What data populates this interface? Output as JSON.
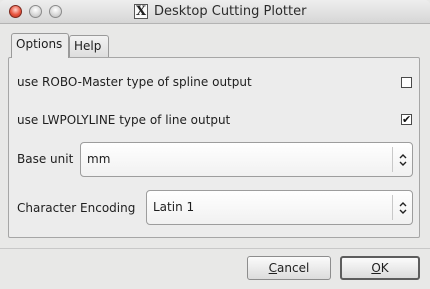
{
  "window": {
    "title": "Desktop Cutting Plotter",
    "app_icon_glyph": "X",
    "controls": [
      "close-icon",
      "minimize-icon",
      "maximize-icon"
    ]
  },
  "tabs": [
    {
      "label": "Options",
      "active": true
    },
    {
      "label": "Help",
      "active": false
    }
  ],
  "options": {
    "robo_master": {
      "label": "use ROBO-Master type of spline output",
      "checked": false
    },
    "lwpolyline": {
      "label": "use LWPOLYLINE type of line output",
      "checked": true,
      "check_glyph": "✔"
    },
    "base_unit": {
      "label": "Base unit",
      "value": "mm"
    },
    "char_encoding": {
      "label": "Character Encoding",
      "value": "Latin 1"
    }
  },
  "buttons": {
    "cancel_mnemonic": "C",
    "cancel_rest": "ancel",
    "ok_mnemonic": "O",
    "ok_rest": "K"
  },
  "colors": {
    "close_button": "#e8553f",
    "window_bg": "#e8e8e7"
  }
}
